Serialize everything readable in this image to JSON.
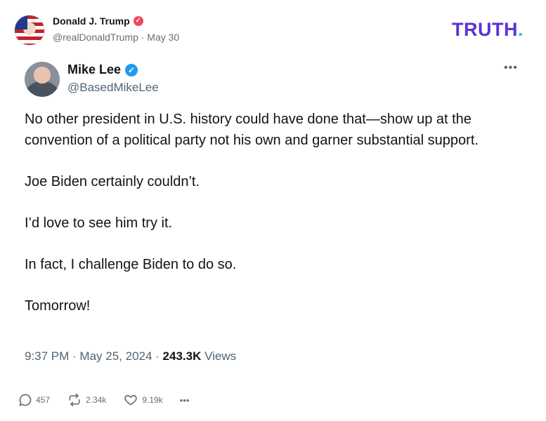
{
  "truth_post": {
    "author_name": "Donald J. Trump",
    "meta": "@realDonaldTrump · May 30",
    "verified_icon": "verified-badge-icon",
    "logo_text": "TRUTH",
    "logo_dot": "."
  },
  "tweet": {
    "author_name": "Mike Lee",
    "handle": "@BasedMikeLee",
    "more_label": "•••",
    "paragraphs": [
      "No other president in U.S. history could have done that—show up at the convention of a political party not his own and garner substantial support.",
      "Joe Biden certainly couldn’t.",
      "I’d love to see him try it.",
      "In fact, I challenge Biden to do so.",
      "Tomorrow!"
    ],
    "timestamp": "9:37 PM · May 25, 2024 · ",
    "views_count": "243.3K",
    "views_label": " Views"
  },
  "actions": {
    "replies": "457",
    "retruths": "2.34k",
    "likes": "9.19k",
    "more": "•••"
  },
  "colors": {
    "truth_brand": "#5b33d6",
    "truth_dot": "#22d1c0",
    "truth_verified": "#f4445a",
    "twitter_verified": "#1d9bf0"
  }
}
